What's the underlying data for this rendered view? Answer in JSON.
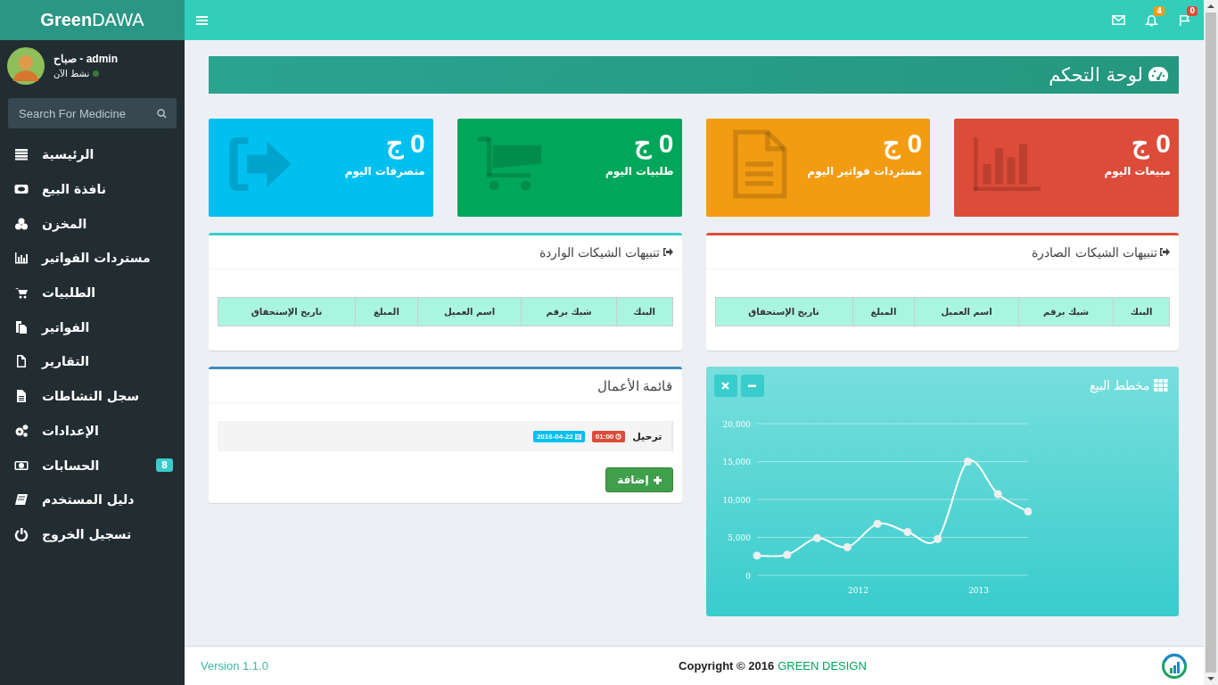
{
  "logo": "**Green**DAWA",
  "header": {
    "icons": [
      {
        "kind": "flag",
        "badge": "0",
        "color": "#dd4b39"
      },
      {
        "kind": "bell",
        "badge": "4",
        "color": "#f39c12"
      },
      {
        "kind": "mail"
      }
    ]
  },
  "user": {
    "name": "صباح - admin",
    "status": "نشط الآن",
    "online": true
  },
  "search": {
    "placeholder": "Search For Medicine"
  },
  "menu": [
    {
      "label": "الرئيسية"
    },
    {
      "label": "نافذة البيع"
    },
    {
      "label": "المخزن"
    },
    {
      "label": "مستردات الفواتير"
    },
    {
      "label": "الطلبيات"
    },
    {
      "label": "الفواتير"
    },
    {
      "label": "التقارير"
    },
    {
      "label": "سجل النشاطات"
    },
    {
      "label": "الإعدادات"
    },
    {
      "label": "الحسابات",
      "badge": "8"
    },
    {
      "label": "دليل المستخدم"
    },
    {
      "label": "تسجيل الخروج"
    }
  ],
  "page_title": "لوحة التحكم",
  "stats": [
    {
      "value": "0 ج",
      "label": "مبيعات اليوم",
      "color": "#dd4b39"
    },
    {
      "value": "0 ج",
      "label": "مستردات فواتير اليوم",
      "color": "#f39c12"
    },
    {
      "value": "0 ج",
      "label": "طلبيات اليوم",
      "color": "#00a65a"
    },
    {
      "value": "0 ج",
      "label": "منصرفات اليوم",
      "color": "#00c0ef"
    }
  ],
  "alerts": [
    {
      "title": "تنبيهات الشيكات الصادرة",
      "color": "#dd4b39",
      "columns": [
        "البنك",
        "شيك برقم",
        "اسم العميل",
        "المبلغ",
        "تاريخ الإستحقاق"
      ]
    },
    {
      "title": "تنبيهات الشيكات الواردة",
      "color": "#39cccc",
      "columns": [
        "البنك",
        "شيك برقم",
        "اسم العميل",
        "المبلغ",
        "تاريخ الإستحقاق"
      ]
    }
  ],
  "sales_chart": {
    "title": "مخطط البيع",
    "chart_data": {
      "type": "line",
      "x": [
        2011.16,
        2011.41,
        2011.66,
        2011.91,
        2012.16,
        2012.41,
        2012.66,
        2012.91,
        2013.16,
        2013.41
      ],
      "xlim": [
        2011.16,
        2013.41
      ],
      "ylim": [
        0,
        20000
      ],
      "xticks": [
        2012,
        2013
      ],
      "grid": true,
      "yticks": [
        {
          "value": 0,
          "label": "0"
        },
        {
          "value": 5000,
          "label": "5,000"
        },
        {
          "value": 10000,
          "label": "10,000"
        },
        {
          "value": 15000,
          "label": "15,000"
        },
        {
          "value": 20000,
          "label": "20,000"
        }
      ],
      "series": [
        {
          "color": "#ffffff",
          "marker": true,
          "values": [
            2600,
            2700,
            4900,
            3700,
            6800,
            5700,
            4800,
            15000,
            10700,
            8400
          ]
        }
      ]
    }
  },
  "todo": {
    "title": "قائمة الأعمال",
    "color": "#3c8dbc",
    "items": [
      {
        "text": "ترحيل",
        "time": "01:00",
        "date": "2016-04-22"
      }
    ],
    "add_button": "إضافة"
  },
  "footer": {
    "version": "Version 1.1.0",
    "copyright": "Copyright © 2016",
    "company": "GREEN DESIGN"
  }
}
